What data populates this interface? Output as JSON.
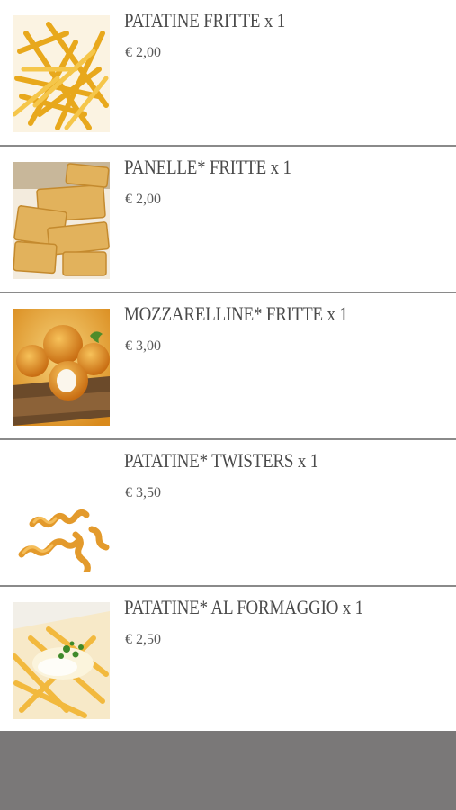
{
  "items": [
    {
      "title": "PATATINE FRITTE x 1",
      "price": "€ 2,00",
      "image": "french-fries-image"
    },
    {
      "title": "PANELLE* FRITTE x 1",
      "price": "€ 2,00",
      "image": "panelle-image"
    },
    {
      "title": "MOZZARELLINE* FRITTE x 1",
      "price": "€ 3,00",
      "image": "mozzarelline-image"
    },
    {
      "title": "PATATINE* TWISTERS x 1",
      "price": "€ 3,50",
      "image": "twisters-image"
    },
    {
      "title": "PATATINE* AL FORMAGGIO x 1",
      "price": "€ 2,50",
      "image": "cheese-fries-image"
    }
  ],
  "colors": {
    "title_text": "#4a4a4a",
    "divider": "#8a8a8a",
    "footer_bar": "#7a7878"
  }
}
